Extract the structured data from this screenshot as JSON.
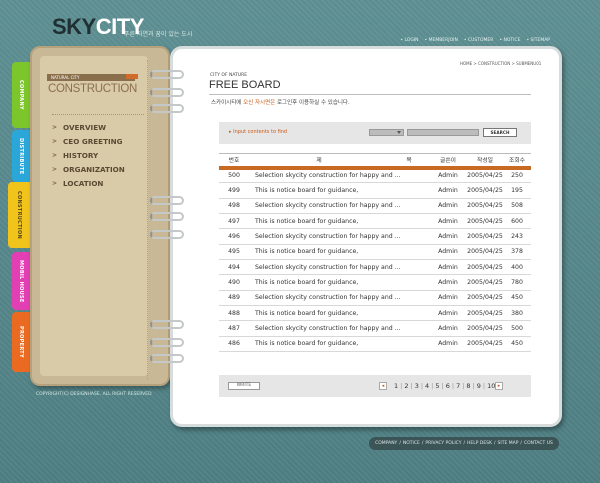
{
  "header": {
    "logo_sky": "SKY",
    "logo_city": "CITY",
    "tagline": "푸른 자연과 꿈이 있는 도시",
    "topnav": [
      "LOGIN",
      "MEMBERJOIN",
      "CUSTOMER",
      "NOTICE",
      "SITEMAP"
    ]
  },
  "sidebar": {
    "small_label": "NATURAL CITY",
    "title": "CONSTRUCTION",
    "menu": [
      "OVERVIEW",
      "CEO GREETING",
      "HISTORY",
      "ORGANIZATION",
      "LOCATION"
    ],
    "copyright": "COPYRIGHT(C) DESIGNHASE. ALL RIGHT RESERVED"
  },
  "tabs": [
    {
      "label": "COMPANY",
      "color": "#7cc52a"
    },
    {
      "label": "DISTRIBUTE",
      "color": "#2aa6d8"
    },
    {
      "label": "CONSTRUCTION",
      "color": "#f0c41a"
    },
    {
      "label": "MOBIL HOUSE",
      "color": "#e23fb5"
    },
    {
      "label": "PROPERTY",
      "color": "#ea6a22"
    }
  ],
  "page": {
    "breadcrumb": "HOME > CONSTRUCTION > SUBMENU01",
    "small": "CITY OF NATURE",
    "title": "FREE BOARD",
    "desc_pre": "스카이시티에 ",
    "desc_hl": "오신 자시면은",
    "desc_post": " 로그인후 이용하실 수 있습니다."
  },
  "search": {
    "hint": "Input contents to find",
    "button": "SEARCH"
  },
  "table": {
    "headers": [
      "번호",
      "제",
      "목",
      "글쓴이",
      "작성일",
      "조회수"
    ],
    "rows": [
      [
        "500",
        "Selection skycity construction for happy and ...",
        "Admin",
        "2005/04/25",
        "250"
      ],
      [
        "499",
        "This is notice board for guidance,",
        "Admin",
        "2005/04/25",
        "195"
      ],
      [
        "498",
        "Selection skycity construction for happy and ...",
        "Admin",
        "2005/04/25",
        "508"
      ],
      [
        "497",
        "This is notice board for guidance,",
        "Admin",
        "2005/04/25",
        "600"
      ],
      [
        "496",
        "Selection skycity construction for happy and ...",
        "Admin",
        "2005/04/25",
        "243"
      ],
      [
        "495",
        "This is notice board for guidance,",
        "Admin",
        "2005/04/25",
        "378"
      ],
      [
        "494",
        "Selection skycity construction for happy and ...",
        "Admin",
        "2005/04/25",
        "400"
      ],
      [
        "490",
        "This is notice board for guidance,",
        "Admin",
        "2005/04/25",
        "780"
      ],
      [
        "489",
        "Selection skycity construction for happy and ...",
        "Admin",
        "2005/04/25",
        "450"
      ],
      [
        "488",
        "This is notice board for guidance,",
        "Admin",
        "2005/04/25",
        "380"
      ],
      [
        "487",
        "Selection skycity construction for happy and ...",
        "Admin",
        "2005/04/25",
        "500"
      ],
      [
        "486",
        "This is notice board for guidance,",
        "Admin",
        "2005/04/25",
        "450"
      ]
    ]
  },
  "pager": {
    "write": "WRITE",
    "prev": "◂",
    "next": "▸",
    "pages": [
      "1",
      "2",
      "3",
      "4",
      "5",
      "6",
      "7",
      "8",
      "9",
      "10"
    ]
  },
  "footer": [
    "COMPANY",
    "NOTICE",
    "PRIVACY POLICY",
    "HELP DESK",
    "SITE MAP",
    "CONTACT US"
  ]
}
